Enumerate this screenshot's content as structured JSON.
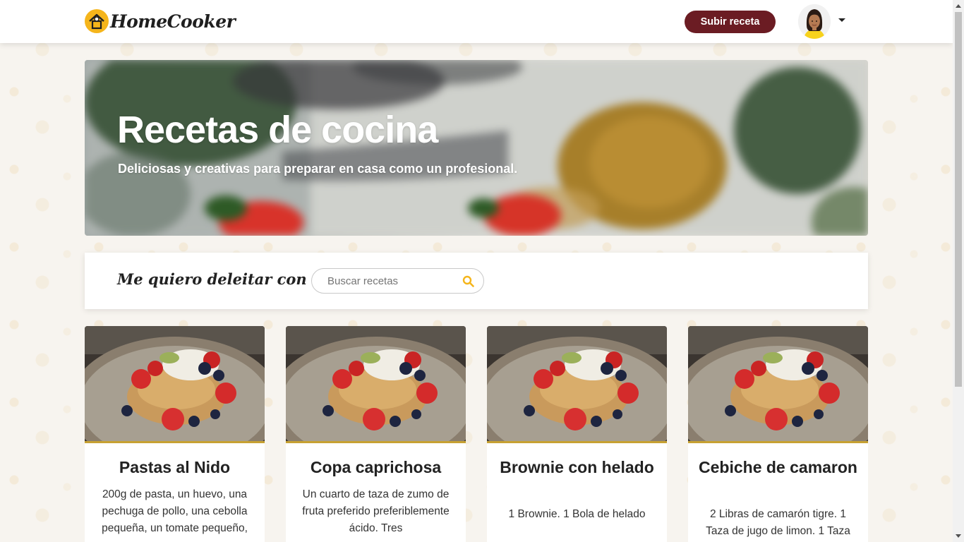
{
  "navbar": {
    "logo_text": "HomeCooker",
    "upload_label": "Subir receta"
  },
  "hero": {
    "title": "Recetas de cocina",
    "subtitle": "Deliciosas y creativas para preparar en casa como un profesional."
  },
  "search": {
    "label": "Me quiero deleitar con",
    "placeholder": "Buscar recetas"
  },
  "recipes": [
    {
      "title": "Pastas al Nido",
      "description": "200g de pasta, un huevo, una pechuga de pollo, una cebolla pequeña, un tomate pequeño,"
    },
    {
      "title": "Copa caprichosa",
      "description": "Un cuarto de taza de zumo de fruta preferido preferiblemente ácido. Tres"
    },
    {
      "title": "Brownie con helado",
      "description": "1 Brownie. 1 Bola de helado"
    },
    {
      "title": "Cebiche de camaron",
      "description": "2 Libras de camarón tigre. 1 Taza de jugo de limon. 1 Taza"
    }
  ],
  "colors": {
    "brand_primary": "#6b1c23",
    "accent_yellow": "#f5b51b",
    "background": "#f7f4ef"
  },
  "icons": {
    "logo": "chef-hat-house-icon",
    "search": "search-icon",
    "avatar": "user-avatar",
    "dropdown": "caret-down-icon"
  }
}
